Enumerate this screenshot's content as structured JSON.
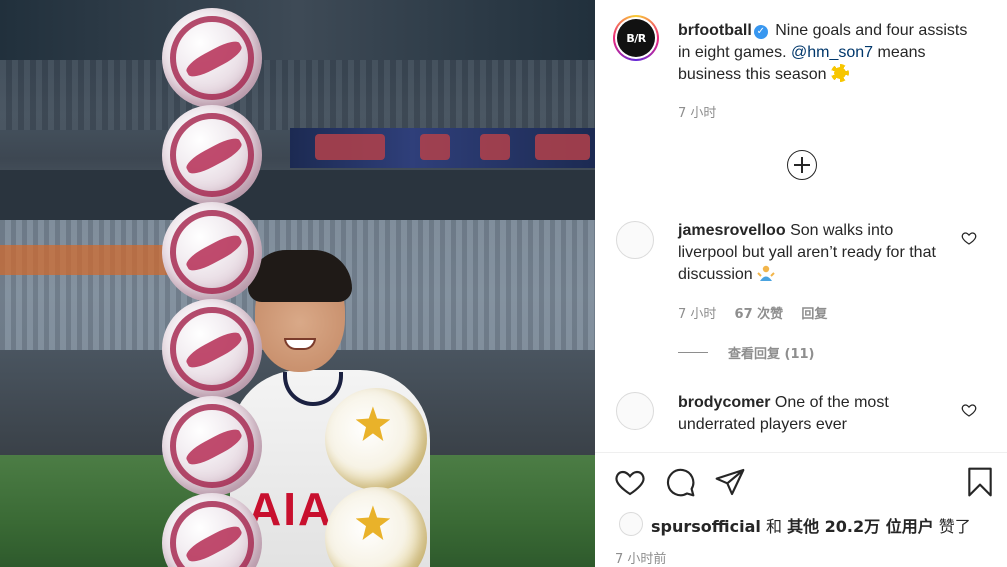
{
  "post": {
    "author": "brfootball",
    "author_logo_text": "B/R",
    "caption_text": "Nine goals and four assists in eight games.",
    "caption_mention": "@hm_son7",
    "caption_tail": "means business this season",
    "time": "7 小时"
  },
  "photo": {
    "jersey_text": "AIA"
  },
  "comments": [
    {
      "user": "jamesrovelloo",
      "text": "Son walks into liverpool but yall aren’t ready for that discussion",
      "time": "7 小时",
      "likes": "67 次赞",
      "reply_label": "回复",
      "view_replies": "查看回复 (11)"
    },
    {
      "user": "brodycomer",
      "text": "One of the most underrated players ever"
    }
  ],
  "likes_line": {
    "user": "spursofficial",
    "and": "和",
    "others": "其他 20.2万 位用户",
    "liked": "赞了"
  },
  "post_time": "7 小时前",
  "icons": {
    "verified": "verified-badge-icon",
    "load_more": "plus-circle-icon",
    "like": "heart-icon",
    "comment": "comment-icon",
    "share": "paper-plane-icon",
    "save": "bookmark-icon"
  },
  "colors": {
    "link": "#00376b",
    "muted": "#8e8e8e",
    "verified": "#3897f0",
    "ball_accent": "#a3214a",
    "jersey_logo": "#c8102e"
  }
}
